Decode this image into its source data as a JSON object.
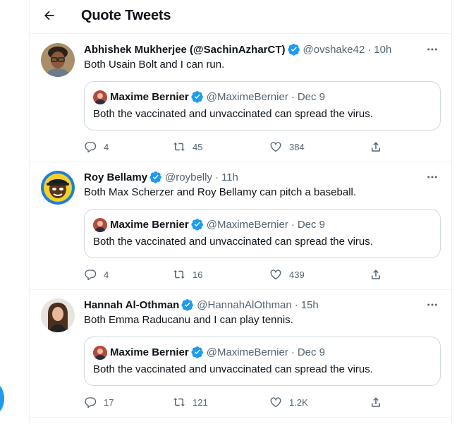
{
  "header": {
    "title": "Quote Tweets"
  },
  "quoted": {
    "name": "Maxime Bernier",
    "handle": "@MaximeBernier",
    "time": "Dec 9",
    "text": "Both the vaccinated and unvaccinated can spread the virus."
  },
  "tweets": [
    {
      "name": "Abhishek Mukherjee (@SachinAzharCT)",
      "handle": "@ovshake42",
      "time": "10h",
      "text": "Both Usain Bolt and I can run.",
      "replies": "4",
      "retweets": "45",
      "likes": "384"
    },
    {
      "name": "Roy Bellamy",
      "handle": "@roybelly",
      "time": "11h",
      "text": "Both Max Scherzer and Roy Bellamy can pitch a baseball.",
      "replies": "4",
      "retweets": "16",
      "likes": "439"
    },
    {
      "name": "Hannah Al-Othman",
      "handle": "@HannahAlOthman",
      "time": "15h",
      "text": "Both Emma Raducanu and I can play tennis.",
      "replies": "17",
      "retweets": "121",
      "likes": "1.2K"
    }
  ],
  "separator": "·",
  "colors": {
    "accent": "#1d9bf0",
    "secondary_text": "#536471",
    "border": "#cfd9de"
  }
}
